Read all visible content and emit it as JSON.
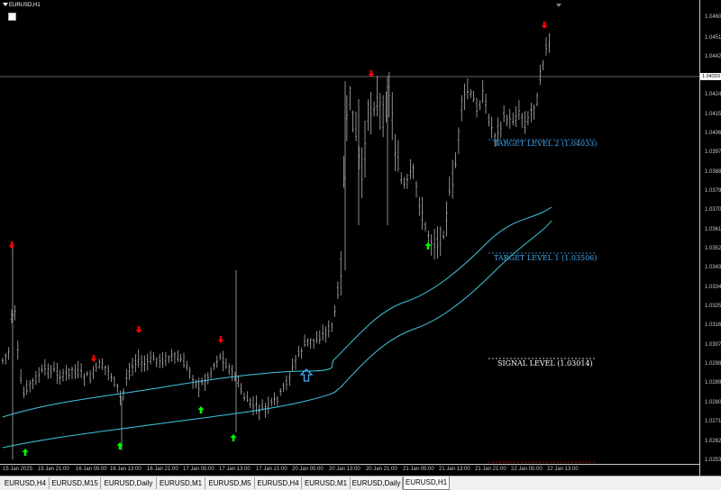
{
  "chart": {
    "symbol_title": "EURUSD,H1",
    "current_price": "1.04333",
    "colors": {
      "background": "#000000",
      "candle": "#c8c8c8",
      "band": "#40c8e0",
      "buy_arrow": "#00ff00",
      "sell_arrow": "#ff0000",
      "target_level": "#3fa9f5",
      "signal_level": "#ffffff",
      "price_line": "#c8c8c8"
    }
  },
  "price_axis": {
    "labels": [
      "1.04600",
      "1.04510",
      "1.04420",
      "1.04333",
      "1.04240",
      "1.04150",
      "1.04060",
      "1.03970",
      "1.03880",
      "1.03790",
      "1.03700",
      "1.03610",
      "1.03520",
      "1.03430",
      "1.03340",
      "1.03250",
      "1.03160",
      "1.03070",
      "1.02980",
      "1.02890",
      "1.02800",
      "1.02710",
      "1.02620",
      "1.02530"
    ]
  },
  "time_axis": {
    "labels": [
      "15 Jan 2025",
      "15 Jan 21:00",
      "16 Jan 05:00",
      "16 Jan 13:00",
      "16 Jan 21:00",
      "17 Jan 05:00",
      "17 Jan 13:00",
      "17 Jan 21:00",
      "20 Jan 05:00",
      "20 Jan 13:00",
      "20 Jan 21:00",
      "21 Jan 05:00",
      "21 Jan 13:00",
      "21 Jan 21:00",
      "22 Jan 05:00",
      "22 Jan 13:00"
    ]
  },
  "levels": {
    "target2": "TARGET LEVEL 2 (1.04033)",
    "target1": "TARGET LEVEL 1 (1.03506)",
    "signal": "SIGNAL LEVEL (1.03014)"
  },
  "tabs": [
    {
      "label": "EURUSD,H4",
      "active": false
    },
    {
      "label": "EURUSD,M15",
      "active": false
    },
    {
      "label": "EURUSD,Daily",
      "active": false
    },
    {
      "label": "EURUSD,M1",
      "active": false
    },
    {
      "label": "EURUSD,M5",
      "active": false
    },
    {
      "label": "EURUSD,H4",
      "active": false
    },
    {
      "label": "EURUSD,M1",
      "active": false
    },
    {
      "label": "EURUSD,Daily",
      "active": false
    },
    {
      "label": "EURUSD,H1",
      "active": true
    }
  ],
  "chart_data": {
    "type": "line",
    "title": "EURUSD,H1",
    "candles_close_approx": [
      1.03,
      1.029,
      1.028,
      1.0285,
      1.029,
      1.0292,
      1.0295,
      1.0293,
      1.029,
      1.0289,
      1.029,
      1.0288,
      1.0291,
      1.0296,
      1.03,
      1.0303,
      1.0302,
      1.03,
      1.0298,
      1.029,
      1.0296,
      1.0303,
      1.03,
      1.029,
      1.0282,
      1.0283,
      1.0287,
      1.029,
      1.0297,
      1.0309,
      1.0312,
      1.031,
      1.0385,
      1.042,
      1.041,
      1.038,
      1.036,
      1.034,
      1.0345,
      1.0365,
      1.036,
      1.0395,
      1.042,
      1.0425,
      1.0408,
      1.0412,
      1.0405,
      1.0417,
      1.0415,
      1.044
    ],
    "ylim": [
      1.0253,
      1.0465
    ]
  }
}
